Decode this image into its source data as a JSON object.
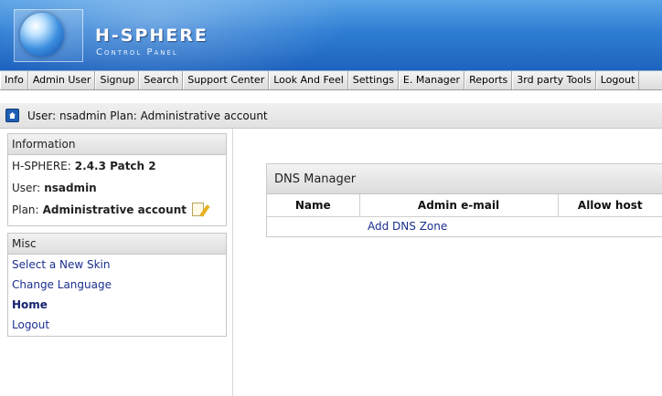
{
  "header": {
    "title": "H-SPHERE",
    "subtitle": "Control Panel"
  },
  "nav": [
    "Info",
    "Admin User",
    "Signup",
    "Search",
    "Support Center",
    "Look And Feel",
    "Settings",
    "E. Manager",
    "Reports",
    "3rd party Tools",
    "Logout"
  ],
  "userbar": {
    "text": "User: nsadmin Plan: Administrative account"
  },
  "sidebar": {
    "information": {
      "heading": "Information",
      "rows": [
        {
          "label": "H-SPHERE:",
          "value": "2.4.3 Patch 2"
        },
        {
          "label": "User:",
          "value": "nsadmin"
        },
        {
          "label": "Plan:",
          "value": "Administrative account"
        }
      ]
    },
    "misc": {
      "heading": "Misc",
      "links": [
        "Select a New Skin",
        "Change Language",
        "Home",
        "Logout"
      ]
    }
  },
  "dns": {
    "title": "DNS Manager",
    "columns": [
      "Name",
      "Admin e-mail",
      "Allow host"
    ],
    "add_label": "Add DNS Zone"
  },
  "colors": {
    "header_blue": "#2f7ed4",
    "link": "#1a2f8f"
  }
}
